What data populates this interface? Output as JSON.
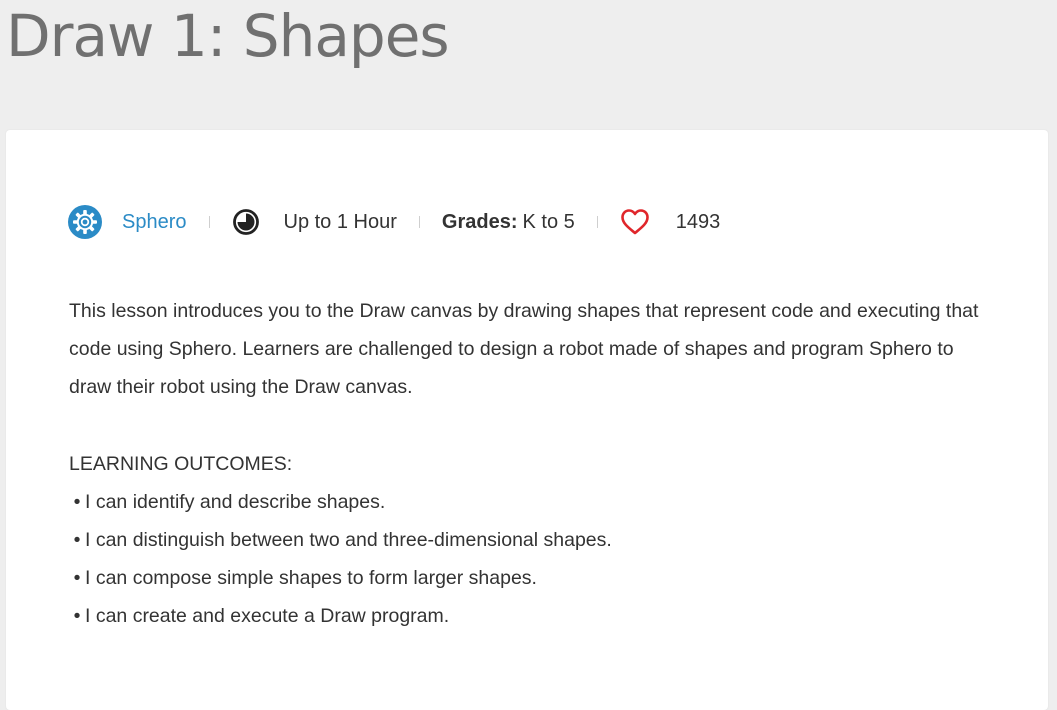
{
  "page": {
    "title": "Draw 1: Shapes"
  },
  "meta": {
    "brand_icon": "sphero-icon",
    "brand_name": "Sphero",
    "duration_icon": "clock-icon",
    "duration": "Up to 1 Hour",
    "grades_label": "Grades:",
    "grades_value": "K to 5",
    "likes_icon": "heart-icon",
    "likes_count": "1493"
  },
  "description": "This lesson introduces you to the Draw canvas by drawing shapes that represent code and executing that code using Sphero. Learners are challenged to design a robot made of shapes and program Sphero to draw their robot using the Draw canvas.",
  "outcomes": {
    "heading": "LEARNING OUTCOMES:",
    "items": [
      "I can identify and describe shapes.",
      "I can distinguish between two and three-dimensional shapes.",
      "I can compose simple shapes to form larger shapes.",
      "I can create and execute a Draw program."
    ]
  },
  "colors": {
    "page_background": "#eeeeee",
    "card_background": "#ffffff",
    "title": "#707070",
    "brand_link": "#2b8bc6",
    "heart": "#e0262b",
    "text": "#333333"
  }
}
